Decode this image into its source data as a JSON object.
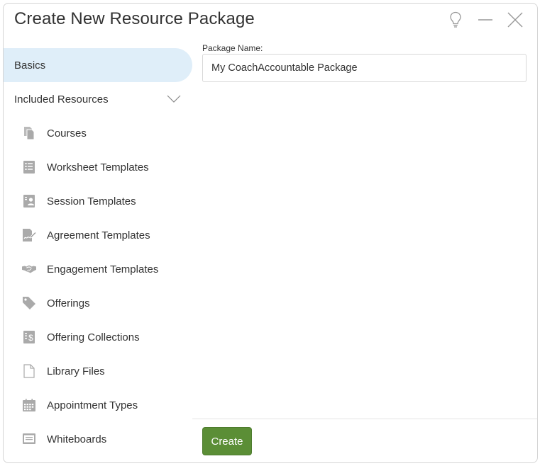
{
  "dialog": {
    "title": "Create New Resource Package"
  },
  "window_icons": [
    "lightbulb-icon",
    "minimize-icon",
    "close-icon"
  ],
  "sidebar": {
    "basics_label": "Basics",
    "section_label": "Included Resources",
    "items": [
      {
        "label": "Courses",
        "icon": "courses-icon"
      },
      {
        "label": "Worksheet Templates",
        "icon": "worksheet-icon"
      },
      {
        "label": "Session Templates",
        "icon": "session-icon"
      },
      {
        "label": "Agreement Templates",
        "icon": "agreement-icon"
      },
      {
        "label": "Engagement Templates",
        "icon": "handshake-icon"
      },
      {
        "label": "Offerings",
        "icon": "tag-icon"
      },
      {
        "label": "Offering Collections",
        "icon": "dollar-icon"
      },
      {
        "label": "Library Files",
        "icon": "file-icon"
      },
      {
        "label": "Appointment Types",
        "icon": "calendar-icon"
      },
      {
        "label": "Whiteboards",
        "icon": "whiteboard-icon"
      }
    ]
  },
  "form": {
    "package_name_label": "Package Name:",
    "package_name_value": "My CoachAccountable Package"
  },
  "footer": {
    "create_label": "Create"
  },
  "colors": {
    "accent_selected_bg": "#dfeef9",
    "create_button": "#5b8e36",
    "icon_gray": "#aaaaaa"
  }
}
